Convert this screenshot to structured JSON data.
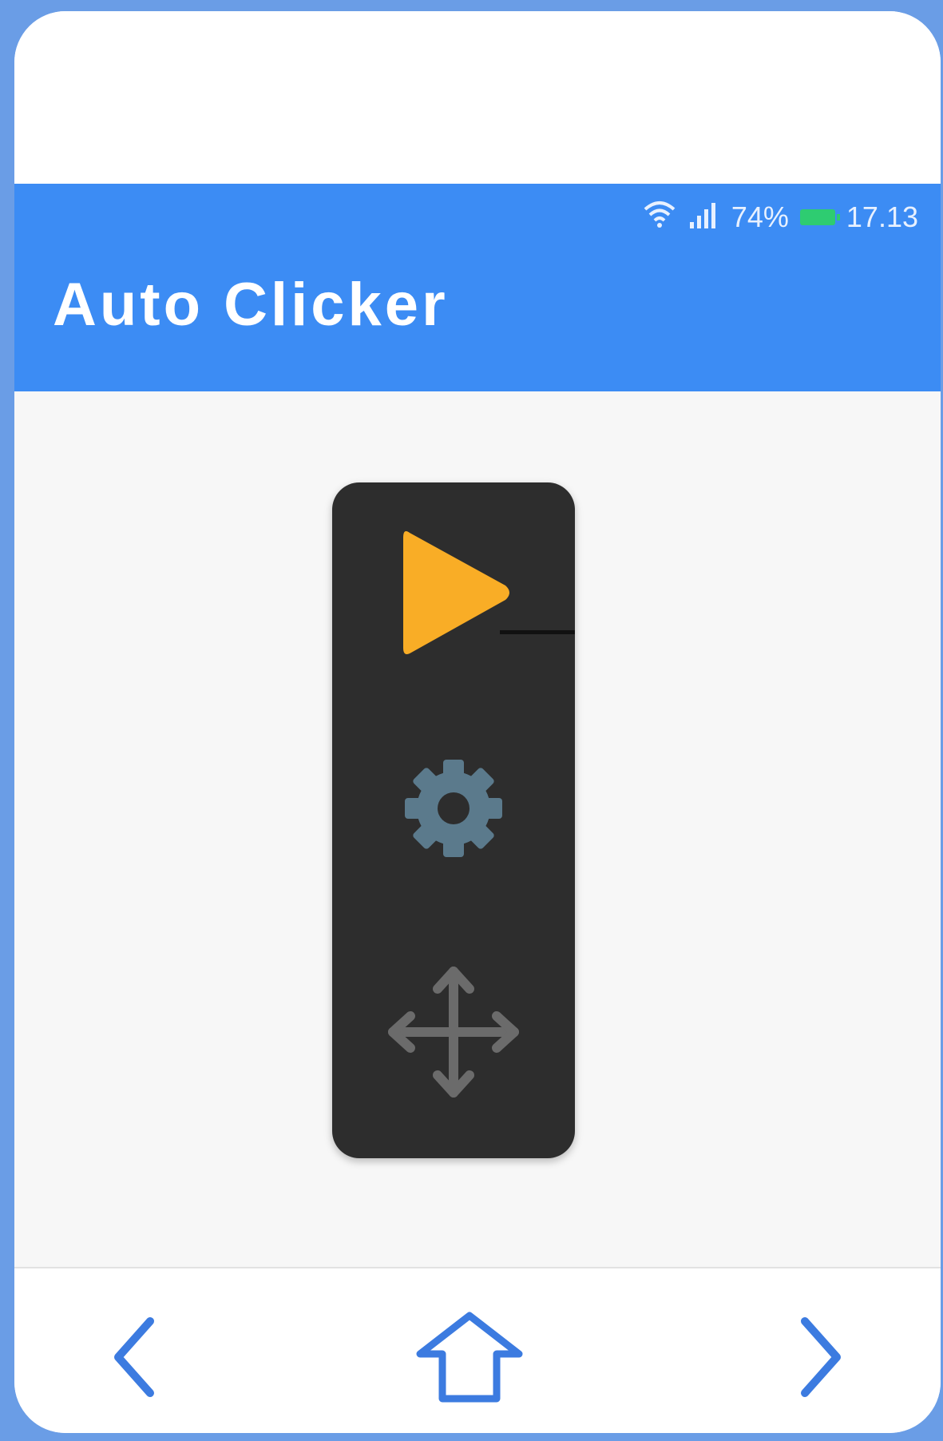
{
  "status_bar": {
    "signal_icon": "signal-bars-icon",
    "wifi_icon": "wifi-icon",
    "battery_percent": "74%",
    "battery_icon": "battery-charging-icon",
    "time": "17.13"
  },
  "app_bar": {
    "title": "Auto Clicker"
  },
  "floating_panel": {
    "buttons": [
      {
        "name": "play",
        "icon": "play-icon",
        "color": "#f9ad26"
      },
      {
        "name": "settings",
        "icon": "gear-icon",
        "color": "#5b7a8c"
      },
      {
        "name": "move",
        "icon": "move-arrows-icon",
        "color": "#6b6b6b"
      }
    ]
  },
  "nav_bar": {
    "back_icon": "chevron-left-icon",
    "home_icon": "home-arrow-icon",
    "forward_icon": "chevron-right-icon",
    "icon_color": "#3c7be0"
  },
  "colors": {
    "app_bar": "#3c8cf4",
    "panel": "#2d2d2d",
    "content_bg": "#f7f7f7"
  }
}
